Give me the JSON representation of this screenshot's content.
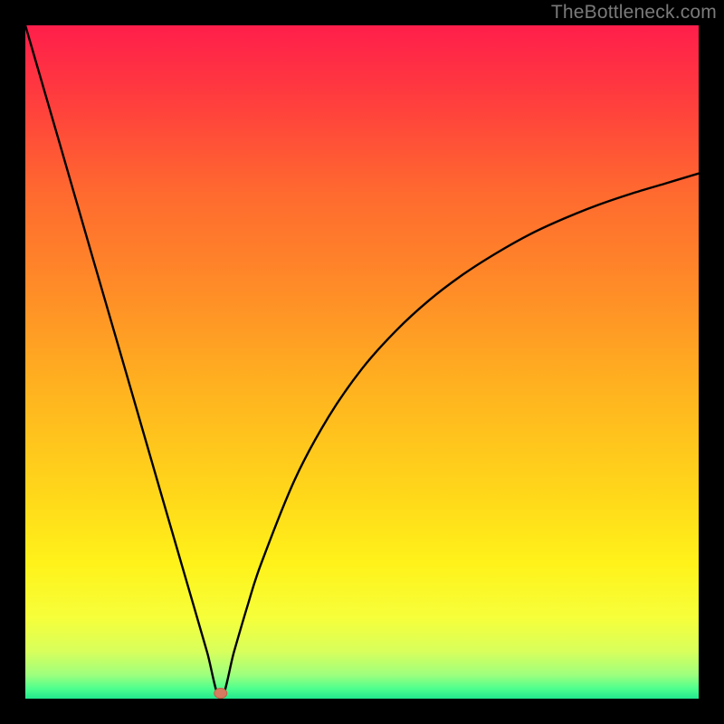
{
  "watermark": "TheBottleneck.com",
  "colors": {
    "frame": "#000000",
    "curve": "#000000",
    "marker_fill": "#d87a5f",
    "marker_stroke": "#c06247",
    "gradient_stops": [
      {
        "offset": 0.0,
        "color": "#ff1e4b"
      },
      {
        "offset": 0.1,
        "color": "#ff3a3f"
      },
      {
        "offset": 0.25,
        "color": "#ff6a2f"
      },
      {
        "offset": 0.4,
        "color": "#ff8e27"
      },
      {
        "offset": 0.55,
        "color": "#ffb51f"
      },
      {
        "offset": 0.7,
        "color": "#ffd81a"
      },
      {
        "offset": 0.8,
        "color": "#fff21a"
      },
      {
        "offset": 0.88,
        "color": "#f6ff3a"
      },
      {
        "offset": 0.93,
        "color": "#d8ff5c"
      },
      {
        "offset": 0.965,
        "color": "#9dff7e"
      },
      {
        "offset": 0.985,
        "color": "#4eff8e"
      },
      {
        "offset": 1.0,
        "color": "#22e88e"
      }
    ]
  },
  "chart_data": {
    "type": "line",
    "title": "",
    "xlabel": "",
    "ylabel": "",
    "xlim": [
      0,
      100
    ],
    "ylim": [
      0,
      100
    ],
    "note": "Bottleneck-style V-curve. Minimum at x≈29 where y≈0. Left branch rises roughly linearly to y=100 at x=0. Right branch rises concavely toward y≈78 at x=100.",
    "series": [
      {
        "name": "curve",
        "x": [
          0,
          5,
          10,
          15,
          20,
          25,
          27,
          29,
          31,
          33,
          35,
          40,
          45,
          50,
          55,
          60,
          65,
          70,
          75,
          80,
          85,
          90,
          95,
          100
        ],
        "y": [
          100,
          82.8,
          65.5,
          48.3,
          31.0,
          13.8,
          6.9,
          0.0,
          7.0,
          13.8,
          20.0,
          32.5,
          41.8,
          49.0,
          54.6,
          59.2,
          63.0,
          66.2,
          69.0,
          71.3,
          73.3,
          75.0,
          76.5,
          78.0
        ]
      }
    ],
    "marker": {
      "x": 29,
      "y": 0.8
    }
  }
}
